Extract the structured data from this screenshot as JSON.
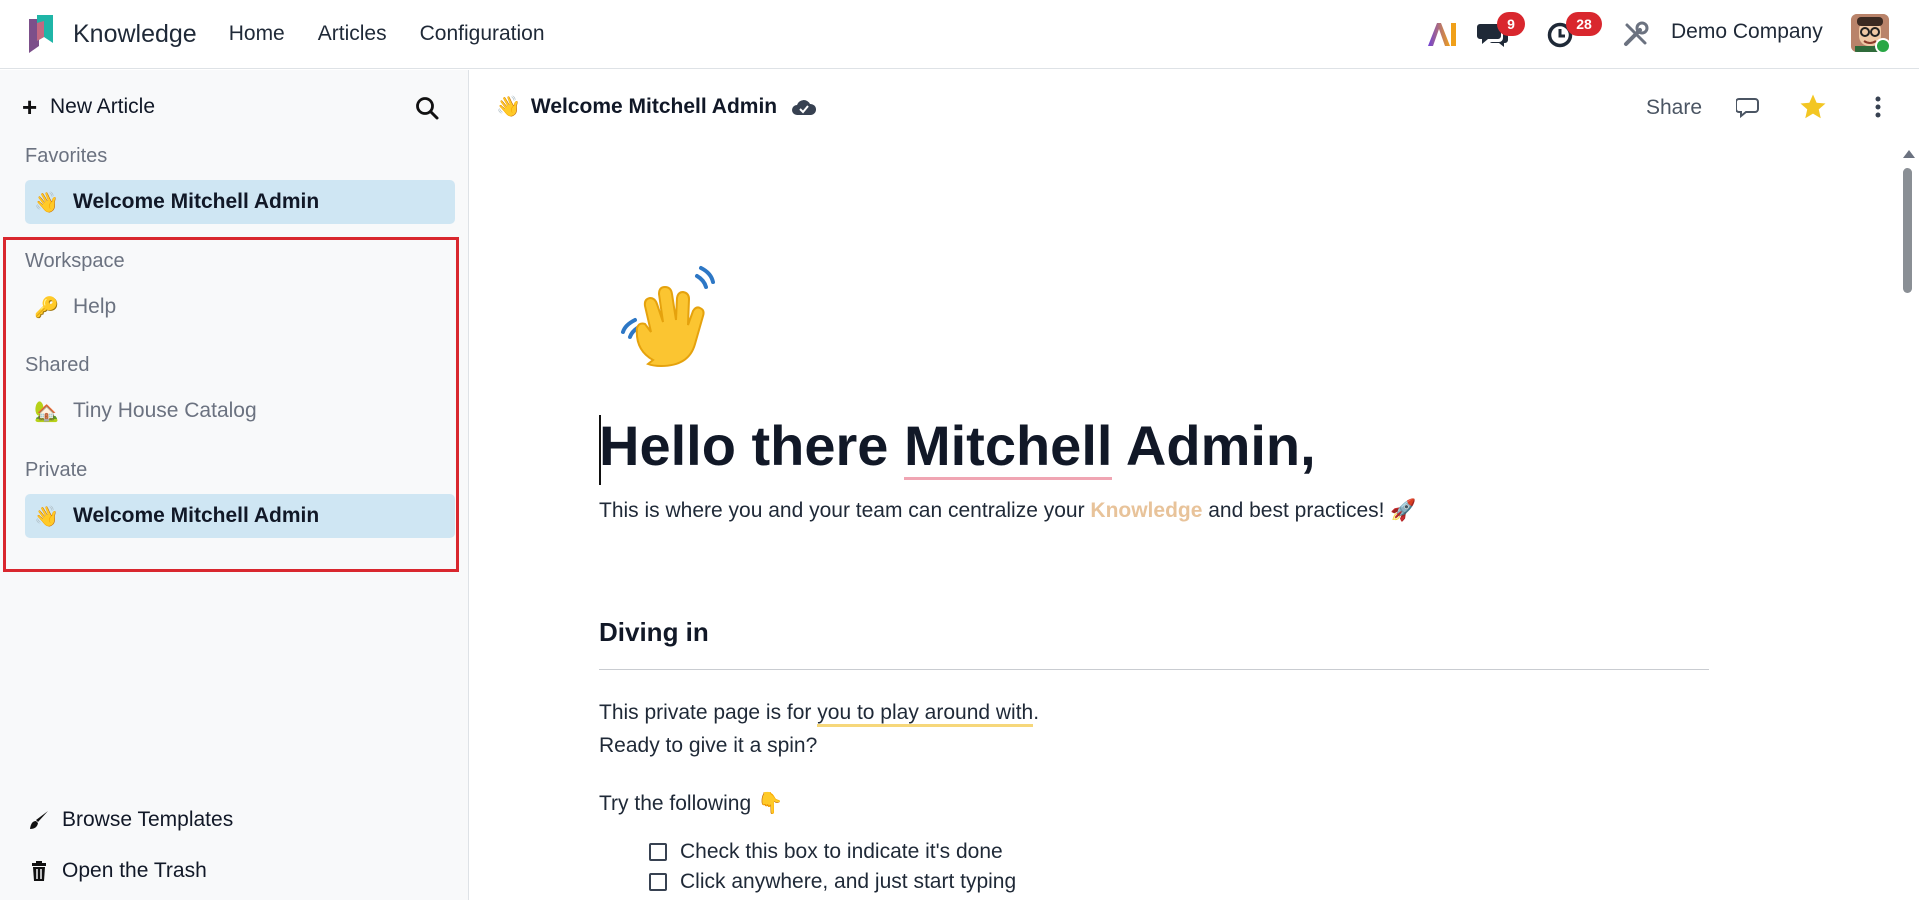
{
  "navbar": {
    "app_name": "Knowledge",
    "menu": [
      {
        "label": "Home"
      },
      {
        "label": "Articles"
      },
      {
        "label": "Configuration"
      }
    ],
    "ai_label": "AI",
    "messages_count": "9",
    "activities_count": "28",
    "company": "Demo Company",
    "colors": {
      "badge": "#d9272e",
      "brand_teal": "#1fb5a7",
      "brand_purple": "#7c4f8a"
    }
  },
  "sidebar": {
    "new_article": "New Article",
    "favorites_title": "Favorites",
    "favorites": [
      {
        "emoji": "👋",
        "name": "Welcome Mitchell Admin",
        "active": true
      }
    ],
    "workspace_title": "Workspace",
    "workspace": [
      {
        "emoji": "🔑",
        "name": "Help"
      }
    ],
    "shared_title": "Shared",
    "shared": [
      {
        "emoji": "🏡",
        "name": "Tiny House Catalog"
      }
    ],
    "private_title": "Private",
    "private": [
      {
        "emoji": "👋",
        "name": "Welcome Mitchell Admin",
        "active": true
      }
    ],
    "browse_templates": "Browse Templates",
    "open_trash": "Open the Trash",
    "active_bg": "#cfe6f3"
  },
  "topbar": {
    "emoji": "👋",
    "title": "Welcome Mitchell Admin",
    "share": "Share"
  },
  "article": {
    "heading_part1": "Hello there ",
    "heading_name": "Mitchell",
    "heading_part2": " Admin,",
    "lead_part1": "This is where you and your team can centralize your ",
    "lead_keyword": "Knowledge",
    "lead_part2": " and best practices! 🚀",
    "section_title": "Diving in",
    "para1_part1": "This private page is for ",
    "para1_highlight": "you to play around with",
    "para1_part2": ".",
    "para2": "Ready to give it a spin?",
    "para3": "Try the following 👇",
    "checklist": [
      {
        "label": "Check this box to indicate it's done"
      },
      {
        "label": "Click anywhere, and just start typing"
      }
    ]
  }
}
